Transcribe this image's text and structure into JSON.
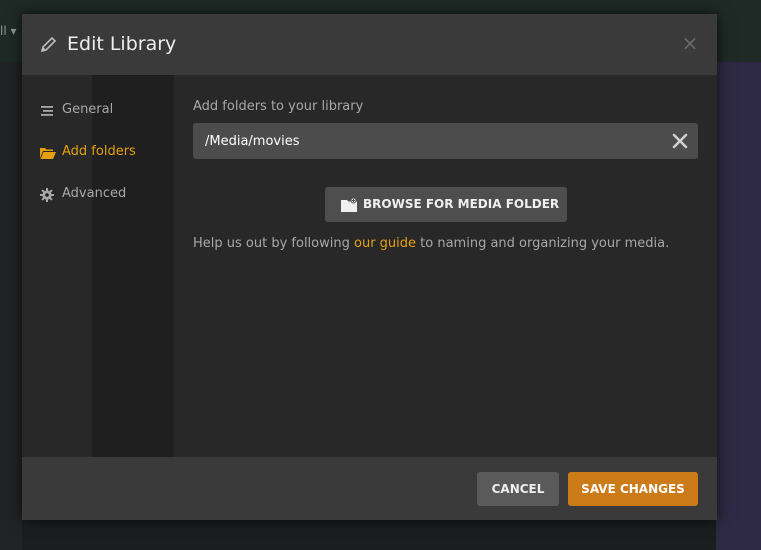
{
  "background": {
    "corner_text": "ll ▾"
  },
  "modal": {
    "title": "Edit Library",
    "close_glyph": "×"
  },
  "sidebar": {
    "items": [
      {
        "label": "General",
        "icon": "list-icon",
        "active": false
      },
      {
        "label": "Add folders",
        "icon": "folder-open-icon",
        "active": true
      },
      {
        "label": "Advanced",
        "icon": "gear-icon",
        "active": false
      }
    ]
  },
  "content": {
    "section_label": "Add folders to your library",
    "folder_value": "/Media/movies",
    "browse_label": "BROWSE FOR MEDIA FOLDER",
    "help_prefix": "Help us out by following ",
    "help_link": "our guide",
    "help_suffix": " to naming and organizing your media."
  },
  "footer": {
    "cancel_label": "CANCEL",
    "save_label": "SAVE CHANGES"
  },
  "colors": {
    "accent": "#e5a00d",
    "save_button": "#cc7b19",
    "modal_bg": "#282828",
    "header_bg": "#3a3a3a"
  }
}
